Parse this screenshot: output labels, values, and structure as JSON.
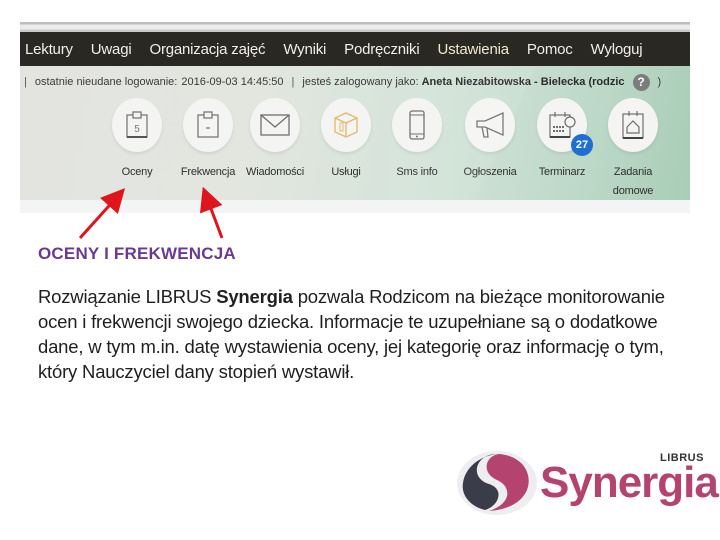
{
  "nav": {
    "items": [
      "Lektury",
      "Uwagi",
      "Organizacja zajęć",
      "Wyniki",
      "Podręczniki",
      "Ustawienia",
      "Pomoc",
      "Wyloguj"
    ]
  },
  "infobar": {
    "separator": "|",
    "last_failed_login_label": "ostatnie nieudane logowanie:",
    "last_failed_login_value": "2016-09-03 14:45:50",
    "logged_in_label": "jesteś zalogowany jako:",
    "user": "Aneta Niezabitowska - Bielecka (rodzic",
    "help_glyph": "?",
    "closing": ")"
  },
  "tiles": [
    {
      "label": "Oceny",
      "icon": "grades-clipboard-icon",
      "glyph": "5"
    },
    {
      "label": "Frekwencja",
      "icon": "attendance-clipboard-icon",
      "glyph": "-"
    },
    {
      "label": "Wiadomości",
      "icon": "envelope-icon"
    },
    {
      "label": "Usługi",
      "icon": "box-icon"
    },
    {
      "label": "Sms info",
      "icon": "phone-icon"
    },
    {
      "label": "Ogłoszenia",
      "icon": "megaphone-icon"
    },
    {
      "label": "Terminarz",
      "icon": "calendar-icon",
      "badge": "27"
    },
    {
      "label": "Zadania domowe",
      "label_line1": "Zadania",
      "label_line2": "domowe",
      "icon": "homework-icon"
    }
  ],
  "colors": {
    "nav_bg": "#292823",
    "heading": "#6b3a90",
    "arrow": "#e0141c",
    "badge": "#1f6fd0",
    "logo": "#b5436f"
  },
  "content": {
    "heading": "OCENY I FREKWENCJA",
    "paragraph_part1": "Rozwiązanie LIBRUS ",
    "paragraph_bold": "Synergia",
    "paragraph_part2": " pozwala Rodzicom na bieżące monitorowanie ocen i frekwencji swojego dziecka. Informacje te uzupełniane są o dodatkowe dane, w tym m.in. datę wystawienia oceny, jej kategorię oraz informację o tym, który Nauczyciel dany stopień wystawił."
  },
  "logo": {
    "brand_small": "LIBRUS",
    "brand_word": "Synergia"
  }
}
